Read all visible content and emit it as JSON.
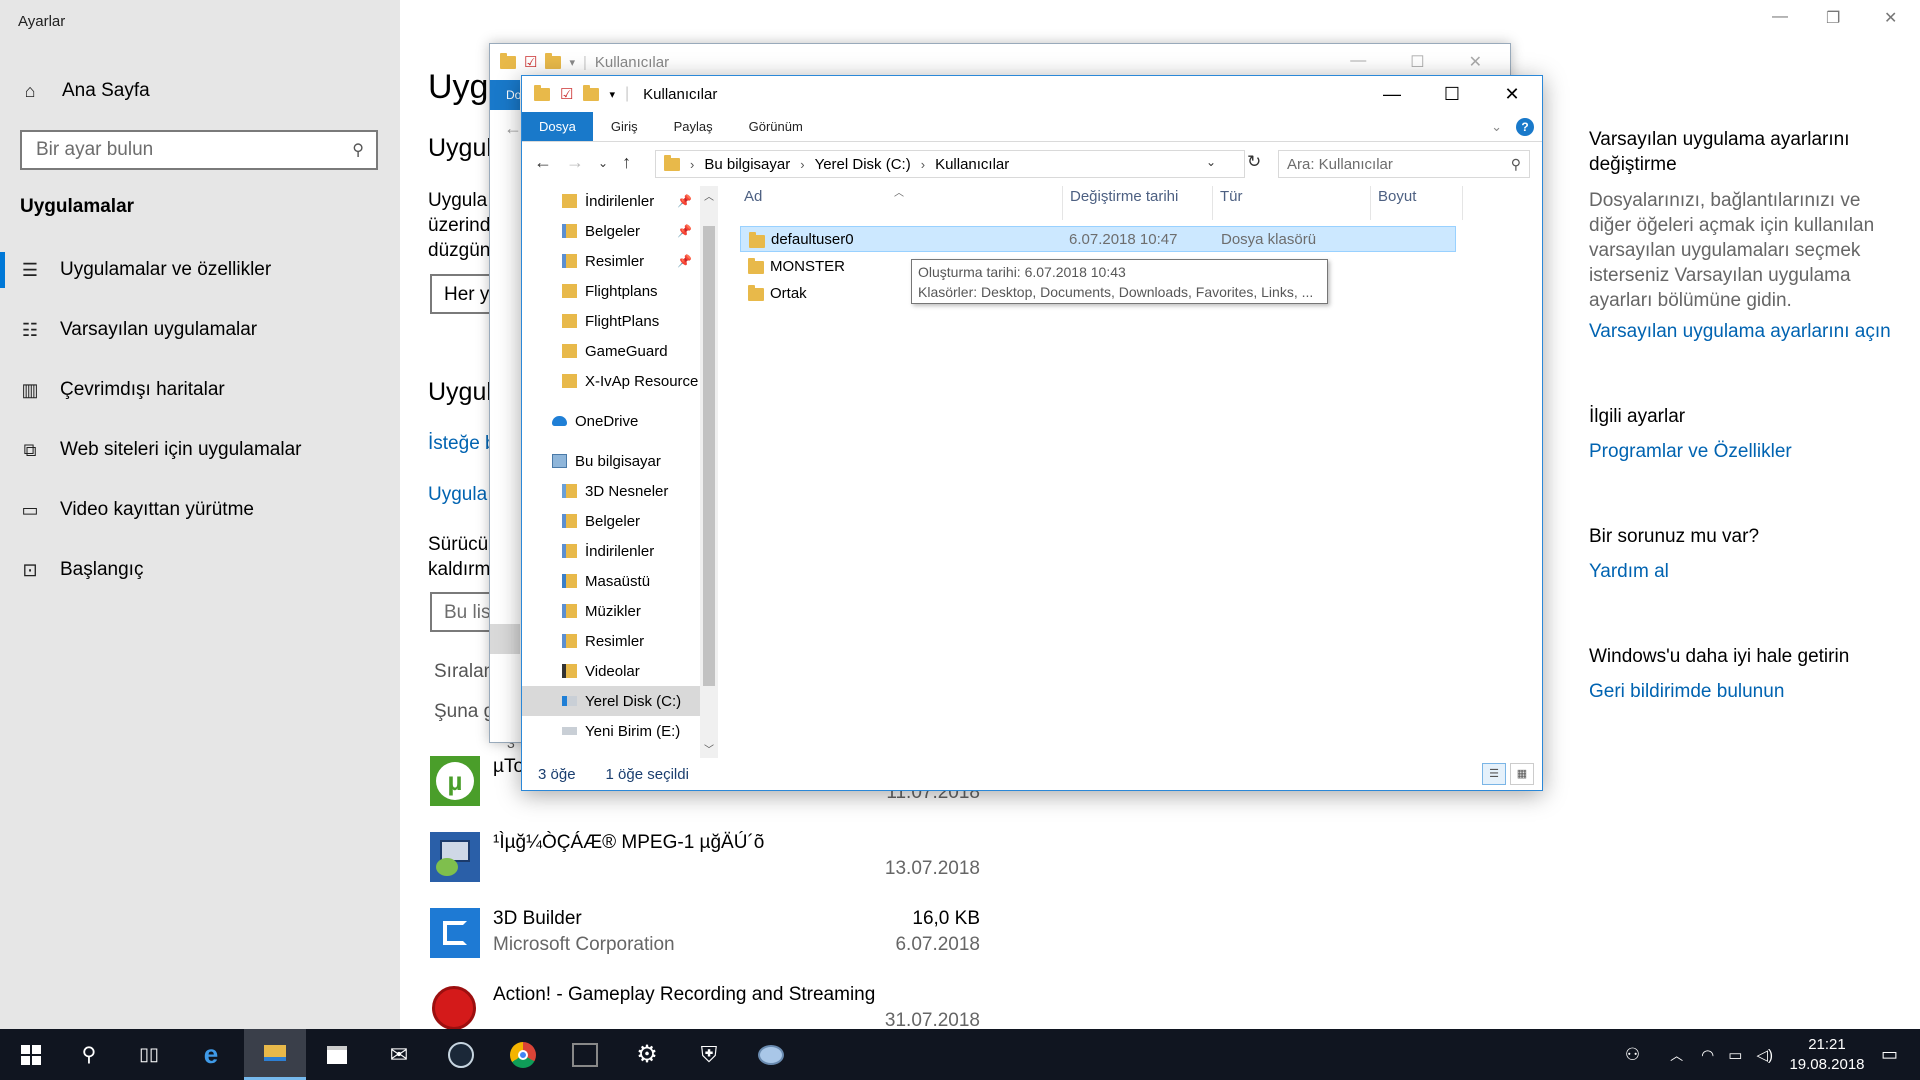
{
  "settings": {
    "window_title": "Ayarlar",
    "home": "Ana Sayfa",
    "search_placeholder": "Bir ayar bulun",
    "section": "Uygulamalar",
    "nav": [
      {
        "label": "Uygulamalar ve özellikler",
        "icon": "list-icon"
      },
      {
        "label": "Varsayılan uygulamalar",
        "icon": "default-apps-icon"
      },
      {
        "label": "Çevrimdışı haritalar",
        "icon": "map-icon"
      },
      {
        "label": "Web siteleri için uygulamalar",
        "icon": "web-app-icon"
      },
      {
        "label": "Video kayıttan yürütme",
        "icon": "video-icon"
      },
      {
        "label": "Başlangıç",
        "icon": "startup-icon"
      }
    ],
    "main": {
      "title": "Uyg",
      "subtitle1": "Uygul",
      "para1": [
        "Uygula",
        "üzerind",
        "düzgün"
      ],
      "select1": "Her y",
      "subtitle2": "Uygul",
      "link1": "İsteğe b",
      "link2": "Uygula",
      "para2": [
        "Sürücü",
        "kaldırm"
      ],
      "search2": "Bu lis",
      "sort": "Sıralam",
      "filter": "Şuna g",
      "count_prefix": "3"
    },
    "apps": [
      {
        "name": "µTo",
        "date": "11.07.2018",
        "icon": "utorrent-icon",
        "color": "#4a9e2a"
      },
      {
        "name": "¹Ìµğ¼ÒÇÁÆ® MPEG-1 µğÄÚ´õ",
        "date": "13.07.2018",
        "icon": "installer-icon",
        "color": "#2a5fa8"
      },
      {
        "name": "3D Builder",
        "publisher": "Microsoft Corporation",
        "size": "16,0 KB",
        "date": "6.07.2018",
        "icon": "3d-builder-icon",
        "color": "#1e7ad4"
      },
      {
        "name": "Action! - Gameplay Recording and Streaming",
        "date": "31.07.2018",
        "icon": "action-record-icon",
        "color": "#d41a1a"
      }
    ],
    "right": {
      "title1": "Varsayılan uygulama ayarlarını değiştirme",
      "text1": "Dosyalarınızı, bağlantılarınızı ve diğer öğeleri açmak için kullanılan varsayılan uygulamaları seçmek isterseniz Varsayılan uygulama ayarları bölümüne gidin.",
      "link1": "Varsayılan uygulama ayarlarını açın",
      "title2": "İlgili ayarlar",
      "link2": "Programlar ve Özellikler",
      "title3": "Bir sorunuz mu var?",
      "link3": "Yardım al",
      "title4": "Windows'u daha iyi hale getirin",
      "link4": "Geri bildirimde bulunun"
    }
  },
  "explorer_back": {
    "title": "Kullanıcılar",
    "tab": "Do"
  },
  "explorer": {
    "title": "Kullanıcılar",
    "ribbon_tabs": [
      "Dosya",
      "Giriş",
      "Paylaş",
      "Görünüm"
    ],
    "breadcrumb": [
      "Bu bilgisayar",
      "Yerel Disk (C:)",
      "Kullanıcılar"
    ],
    "search_placeholder": "Ara: Kullanıcılar",
    "nav_pane": [
      {
        "label": "İndirilenler",
        "icon": "downloads-folder-icon",
        "pinned": true,
        "indent": 1
      },
      {
        "label": "Belgeler",
        "icon": "documents-folder-icon",
        "pinned": true,
        "indent": 1
      },
      {
        "label": "Resimler",
        "icon": "pictures-folder-icon",
        "pinned": true,
        "indent": 1
      },
      {
        "label": "Flightplans",
        "icon": "folder-icon",
        "pinned": false,
        "indent": 1
      },
      {
        "label": "FlightPlans",
        "icon": "folder-icon",
        "pinned": false,
        "indent": 1
      },
      {
        "label": "GameGuard",
        "icon": "folder-icon",
        "pinned": false,
        "indent": 1
      },
      {
        "label": "X-IvAp Resource",
        "icon": "folder-icon",
        "pinned": false,
        "indent": 1
      },
      {
        "label": "OneDrive",
        "icon": "onedrive-icon",
        "pinned": false,
        "indent": 0
      },
      {
        "label": "Bu bilgisayar",
        "icon": "computer-icon",
        "pinned": false,
        "indent": 0
      },
      {
        "label": "3D Nesneler",
        "icon": "3d-objects-icon",
        "pinned": false,
        "indent": 1
      },
      {
        "label": "Belgeler",
        "icon": "documents-folder-icon",
        "pinned": false,
        "indent": 1
      },
      {
        "label": "İndirilenler",
        "icon": "downloads-folder-icon",
        "pinned": false,
        "indent": 1
      },
      {
        "label": "Masaüstü",
        "icon": "desktop-folder-icon",
        "pinned": false,
        "indent": 1
      },
      {
        "label": "Müzikler",
        "icon": "music-folder-icon",
        "pinned": false,
        "indent": 1
      },
      {
        "label": "Resimler",
        "icon": "pictures-folder-icon",
        "pinned": false,
        "indent": 1
      },
      {
        "label": "Videolar",
        "icon": "videos-folder-icon",
        "pinned": false,
        "indent": 1
      },
      {
        "label": "Yerel Disk (C:)",
        "icon": "local-disk-icon",
        "pinned": false,
        "indent": 1,
        "selected": true
      },
      {
        "label": "Yeni Birim (E:)",
        "icon": "drive-icon",
        "pinned": false,
        "indent": 1
      }
    ],
    "columns": [
      "Ad",
      "Değiştirme tarihi",
      "Tür",
      "Boyut"
    ],
    "files": [
      {
        "name": "defaultuser0",
        "modified": "6.07.2018 10:47",
        "type": "Dosya klasörü",
        "selected": true
      },
      {
        "name": "MONSTER",
        "modified": "",
        "type": ""
      },
      {
        "name": "Ortak",
        "modified": "",
        "type": ""
      }
    ],
    "tooltip": {
      "line1": "Oluşturma tarihi: 6.07.2018 10:43",
      "line2": "Klasörler: Desktop, Documents, Downloads, Favorites, Links, ..."
    },
    "status": {
      "count": "3 öğe",
      "selected": "1 öğe seçildi"
    }
  },
  "taskbar": {
    "items": [
      "windows-start-icon",
      "search-icon",
      "task-view-icon",
      "edge-icon",
      "file-explorer-icon",
      "store-icon",
      "mail-icon",
      "steam-icon",
      "chrome-icon",
      "nvidia-icon",
      "settings-icon",
      "security-icon",
      "paint-icon"
    ],
    "time": "21:21",
    "date": "19.08.2018"
  },
  "colors": {
    "accent": "#0078d7",
    "link": "#0063b1",
    "sidebar_bg": "#e6e6e6",
    "taskbar_bg": "#101520",
    "folder": "#e8b94a"
  }
}
